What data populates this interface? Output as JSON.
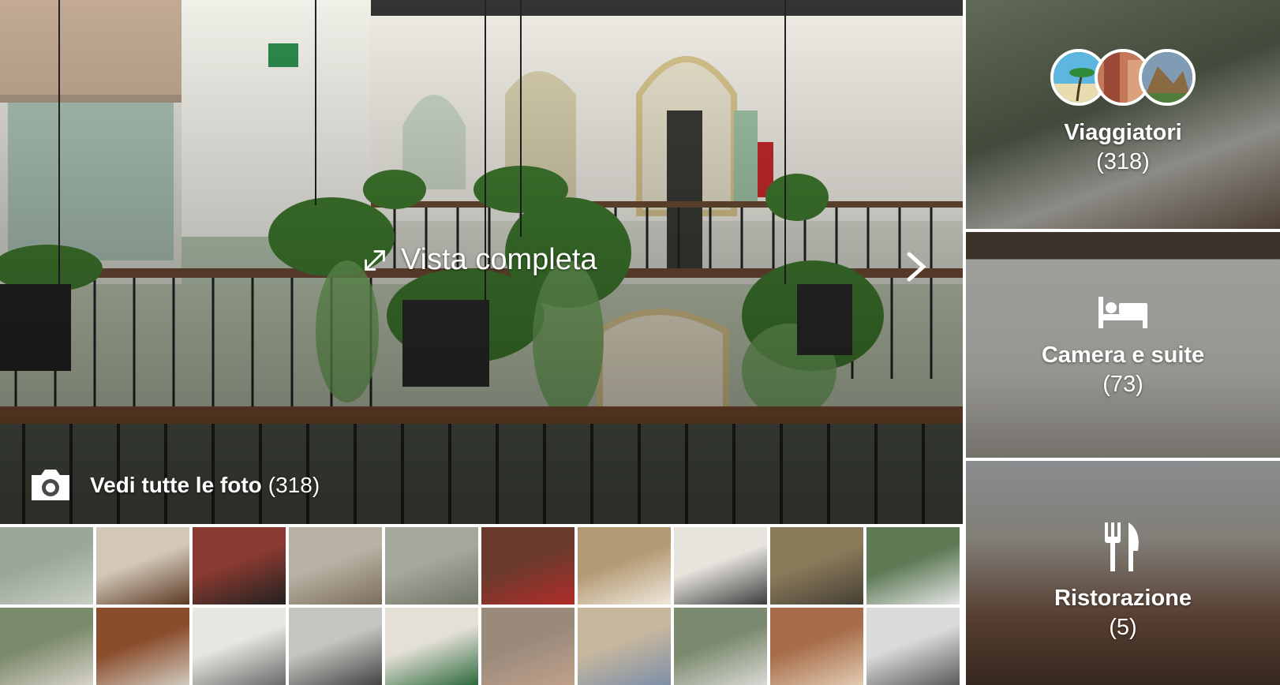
{
  "hero": {
    "full_view_label": "Vista completa",
    "see_all_label": "Vedi tutte le foto",
    "see_all_count": "(318)"
  },
  "icons": {
    "expand": "expand-arrows-icon",
    "next": "chevron-right-icon",
    "camera": "camera-icon",
    "bed": "bed-icon",
    "dining": "fork-knife-icon"
  },
  "thumbnails": [
    {
      "name": "courtyard-balconies",
      "colors": [
        "#9aa89a",
        "#c9cfc4"
      ]
    },
    {
      "name": "cockroaches-wall",
      "colors": [
        "#d2c7b8",
        "#5c3a24"
      ]
    },
    {
      "name": "checkered-floor-bar",
      "colors": [
        "#8a3a30",
        "#222222"
      ]
    },
    {
      "name": "street-balconies",
      "colors": [
        "#b9b2a4",
        "#7b6d5c"
      ]
    },
    {
      "name": "atrium-balconies",
      "colors": [
        "#a5a89d",
        "#6e7466"
      ]
    },
    {
      "name": "restaurant-red-chairs",
      "colors": [
        "#6a3b2c",
        "#b12c2a"
      ]
    },
    {
      "name": "room-twin-beds-1",
      "colors": [
        "#b49a74",
        "#efe8dc"
      ]
    },
    {
      "name": "courtyard-white-walls",
      "colors": [
        "#e7e4de",
        "#3e3e3e"
      ]
    },
    {
      "name": "room-green-window",
      "colors": [
        "#8b7a5a",
        "#454035"
      ]
    },
    {
      "name": "tiled-patio-plants",
      "colors": [
        "#5e7b56",
        "#e5e5e5"
      ]
    },
    {
      "name": "lobby-plants",
      "colors": [
        "#7c8a6c",
        "#d7d3c8"
      ]
    },
    {
      "name": "wooden-doors",
      "colors": [
        "#8a4d2c",
        "#d1cabe"
      ]
    },
    {
      "name": "white-room-bed",
      "colors": [
        "#e8e6e1",
        "#6a6a6a"
      ]
    },
    {
      "name": "railing-balcony",
      "colors": [
        "#c4c4c0",
        "#444444"
      ]
    },
    {
      "name": "bathroom-green-door",
      "colors": [
        "#e4e0d6",
        "#2e6a3e"
      ]
    },
    {
      "name": "dining-group",
      "colors": [
        "#9a8a7c",
        "#c0a18a"
      ]
    },
    {
      "name": "room-double-bed",
      "colors": [
        "#c6b79e",
        "#7d8fa8"
      ]
    },
    {
      "name": "vertical-balconies",
      "colors": [
        "#7b8a6e",
        "#d9d9d4"
      ]
    },
    {
      "name": "breakfast-table",
      "colors": [
        "#a76d4a",
        "#e2cbb2"
      ]
    },
    {
      "name": "shower-fixture",
      "colors": [
        "#dadada",
        "#5a5a5a"
      ]
    }
  ],
  "categories": [
    {
      "title": "Viaggiatori",
      "count": "(318)",
      "icon": "traveler-avatars"
    },
    {
      "title": "Camera e suite",
      "count": "(73)",
      "icon": "bed-icon"
    },
    {
      "title": "Ristorazione",
      "count": "(5)",
      "icon": "fork-knife-icon"
    }
  ]
}
